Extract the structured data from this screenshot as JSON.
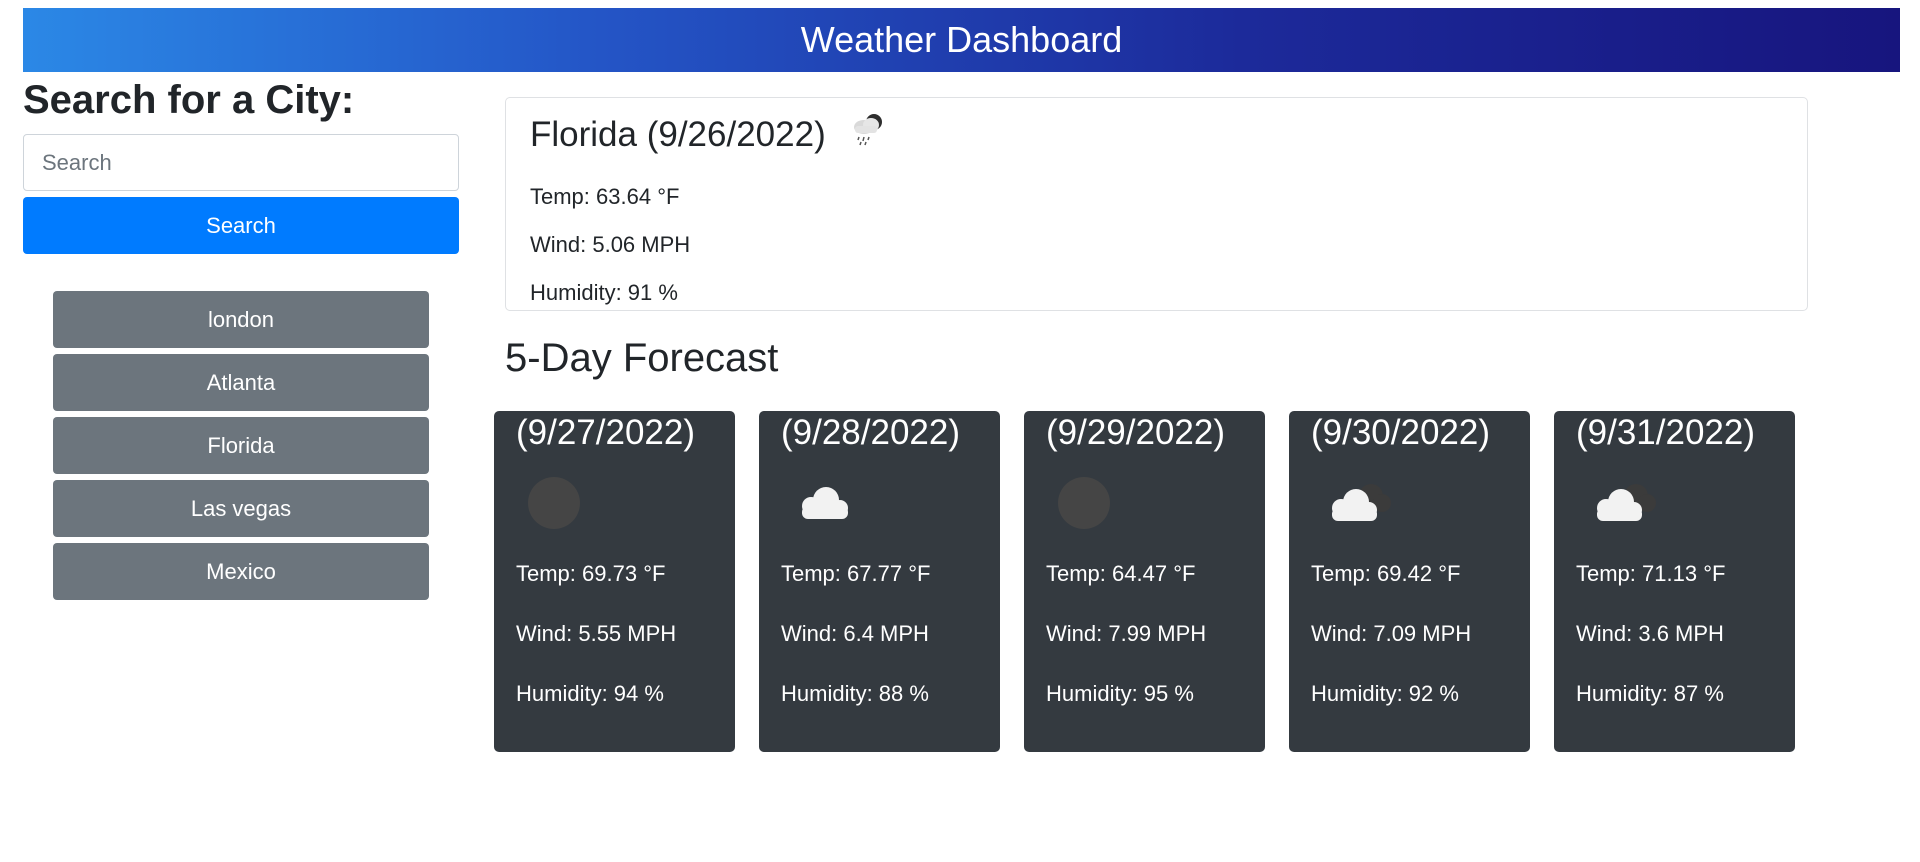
{
  "header": {
    "title": "Weather Dashboard"
  },
  "sidebar": {
    "heading": "Search for a City:",
    "search_placeholder": "Search",
    "search_button_label": "Search",
    "history": [
      "london",
      "Atlanta",
      "Florida",
      "Las vegas",
      "Mexico"
    ]
  },
  "current": {
    "title": "Florida (9/26/2022)",
    "icon": "rain-cloud-icon",
    "temp": "Temp: 63.64 °F",
    "wind": "Wind: 5.06 MPH",
    "humidity": "Humidity: 91 %"
  },
  "forecast": {
    "heading": "5-Day Forecast",
    "days": [
      {
        "date": "(9/27/2022)",
        "icon": "moon-icon",
        "temp": "Temp: 69.73 °F",
        "wind": "Wind: 5.55 MPH",
        "humidity": "Humidity: 94 %"
      },
      {
        "date": "(9/28/2022)",
        "icon": "cloud-icon",
        "temp": "Temp: 67.77 °F",
        "wind": "Wind: 6.4 MPH",
        "humidity": "Humidity: 88 %"
      },
      {
        "date": "(9/29/2022)",
        "icon": "moon-icon",
        "temp": "Temp: 64.47 °F",
        "wind": "Wind: 7.99 MPH",
        "humidity": "Humidity: 95 %"
      },
      {
        "date": "(9/30/2022)",
        "icon": "broken-clouds-icon",
        "temp": "Temp: 69.42 °F",
        "wind": "Wind: 7.09 MPH",
        "humidity": "Humidity: 92 %"
      },
      {
        "date": "(9/31/2022)",
        "icon": "broken-clouds-icon",
        "temp": "Temp: 71.13 °F",
        "wind": "Wind: 3.6 MPH",
        "humidity": "Humidity: 87 %"
      }
    ]
  },
  "colors": {
    "header_gradient_start": "#2b88e6",
    "header_gradient_end": "#17157e",
    "primary_button": "#007bff",
    "history_button": "#6c757d",
    "forecast_card": "#343a40"
  }
}
